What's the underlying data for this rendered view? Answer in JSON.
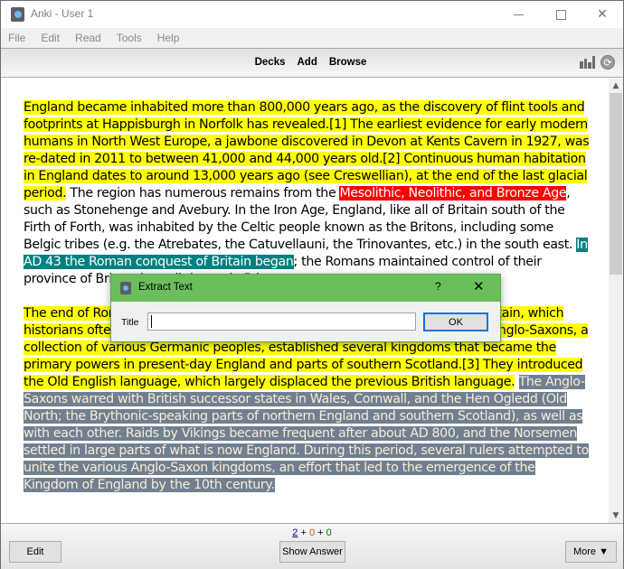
{
  "window": {
    "title": "Anki - User 1",
    "controls": {
      "minimize": "minimize",
      "maximize": "maximize",
      "close": "close"
    }
  },
  "menu": [
    "File",
    "Edit",
    "Read",
    "Tools",
    "Help"
  ],
  "toolbar": {
    "links": [
      "Decks",
      "Add",
      "Browse"
    ],
    "icons": [
      "stats-icon",
      "sync-icon"
    ]
  },
  "article": {
    "paragraphs": [
      [
        {
          "text": "England became inhabited more than 800,000 years ago, as the discovery of flint tools and footprints at Happisburgh in Norfolk has revealed.[1] The earliest evidence for early modern humans in North West Europe, a jawbone discovered in Devon at Kents Cavern in 1927, was re-dated in 2011 to between 41,000 and 44,000 years old.[2] Continuous human habitation in England dates to around 13,000 years ago (see Creswellian), at the end of the last glacial period.",
          "highlight": "yellow"
        },
        {
          "text": " The region has numerous remains from the ",
          "highlight": "none"
        },
        {
          "text": "Mesolithic, Neolithic, and Bronze Age",
          "highlight": "red"
        },
        {
          "text": ", such as Stonehenge and Avebury. In the Iron Age, England, like all of Britain south of the Firth of Forth, was inhabited by the Celtic people known as the Britons, including some Belgic tribes (e.g. the Atrebates, the Catuvellauni, the Trinovantes, etc.) in the south east. ",
          "highlight": "none"
        },
        {
          "text": "In AD 43 the Roman conquest of Britain began",
          "highlight": "teal"
        },
        {
          "text": "; the Romans maintained control of their province of Britannia until the early 5th century.",
          "highlight": "none"
        }
      ],
      [
        {
          "text": "The end of Roman rule in Britain facilitated the Anglo-Saxon settlement of Britain, which historians often regard as the origin of England and the English people. The Anglo-Saxons, a collection of various Germanic peoples, established several kingdoms that became the primary powers in present-day England and parts of southern Scotland.[3] They introduced the Old English language, which largely displaced the previous British language.",
          "highlight": "yellow"
        },
        {
          "text": " ",
          "highlight": "none"
        },
        {
          "text": "The Anglo-Saxons warred with British successor states in Wales, Cornwall, and the Hen Ogledd (Old North; the Brythonic-speaking parts of northern England and southern Scotland), as well as with each other. Raids by Vikings became frequent after about AD 800, and the Norsemen settled in large parts of what is now England. During this period, several rulers attempted to unite the various Anglo-Saxon kingdoms, an effort that led to the emergence of the Kingdom of England by the 10th century.",
          "highlight": "slate"
        }
      ]
    ]
  },
  "highlight_colors": {
    "yellow": "#ffff00",
    "red": "#ff0000",
    "teal": "#008080",
    "slate": "#708090"
  },
  "scroll": {
    "position_fraction": 0.0,
    "visible_fraction": 0.44
  },
  "bottom": {
    "counts": {
      "new": "2",
      "learn": "0",
      "due": "0",
      "separator": "+"
    },
    "edit_label": "Edit",
    "show_answer_label": "Show Answer",
    "more_label": "More ▼"
  },
  "dialog": {
    "title": "Extract Text",
    "help": "?",
    "close": "✕",
    "field_label": "Title",
    "field_value": "",
    "ok_label": "OK",
    "accent": "#6abf5a"
  }
}
